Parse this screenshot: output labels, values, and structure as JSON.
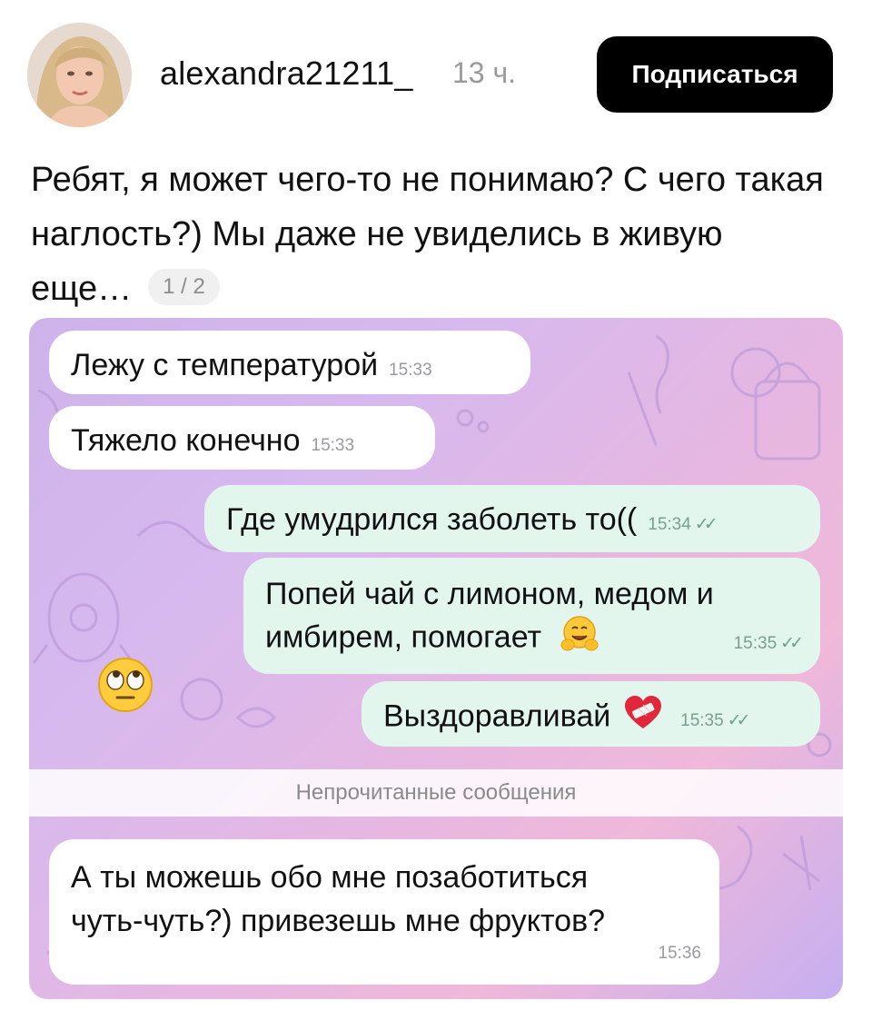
{
  "header": {
    "username": "alexandra21211_",
    "time_ago": "13 ч.",
    "follow_label": "Подписаться"
  },
  "post": {
    "text": "Ребят, я может чего-то не понимаю? С чего такая наглость?) Мы даже не увиделись в живую еще…",
    "pager": "1 / 2"
  },
  "chat": {
    "messages": [
      {
        "text": "Лежу с температурой",
        "time": "15:33"
      },
      {
        "text": "Тяжело конечно",
        "time": "15:33"
      },
      {
        "text": "Где умудрился заболеть то((",
        "time": "15:34"
      },
      {
        "text_line1": "Попей чай с лимоном, медом и",
        "text_line2": "имбирем, помогает",
        "time": "15:35"
      },
      {
        "text": "Выздоравливай",
        "time": "15:35"
      },
      {
        "text_line1": "А ты можешь обо мне позаботиться",
        "text_line2": "чуть-чуть?) привезешь мне фруктов?",
        "time": "15:36"
      }
    ],
    "unread_label": "Непрочитанные сообщения",
    "read_ticks": "✓✓"
  },
  "icons": {
    "hug_emoji": "hugging-face-icon",
    "heart_emoji": "mending-heart-icon",
    "eyeroll_emoji": "eye-roll-emoji-icon"
  }
}
